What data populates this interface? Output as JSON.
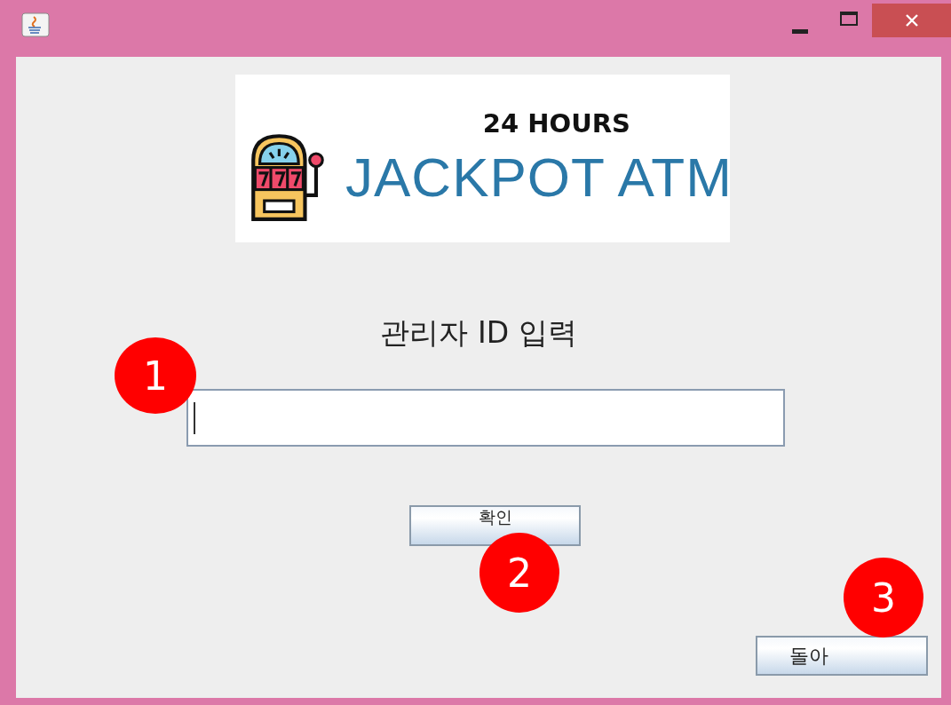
{
  "banner": {
    "tagline": "24 HOURS",
    "title": "JACKPOT ATM"
  },
  "prompt": "관리자 ID 입력",
  "id_field": {
    "focused": true
  },
  "confirm_button": {
    "label": "확인"
  },
  "back_button": {
    "label": "돌아"
  },
  "markers": [
    {
      "number": "1"
    },
    {
      "number": "2"
    },
    {
      "number": "3"
    }
  ]
}
